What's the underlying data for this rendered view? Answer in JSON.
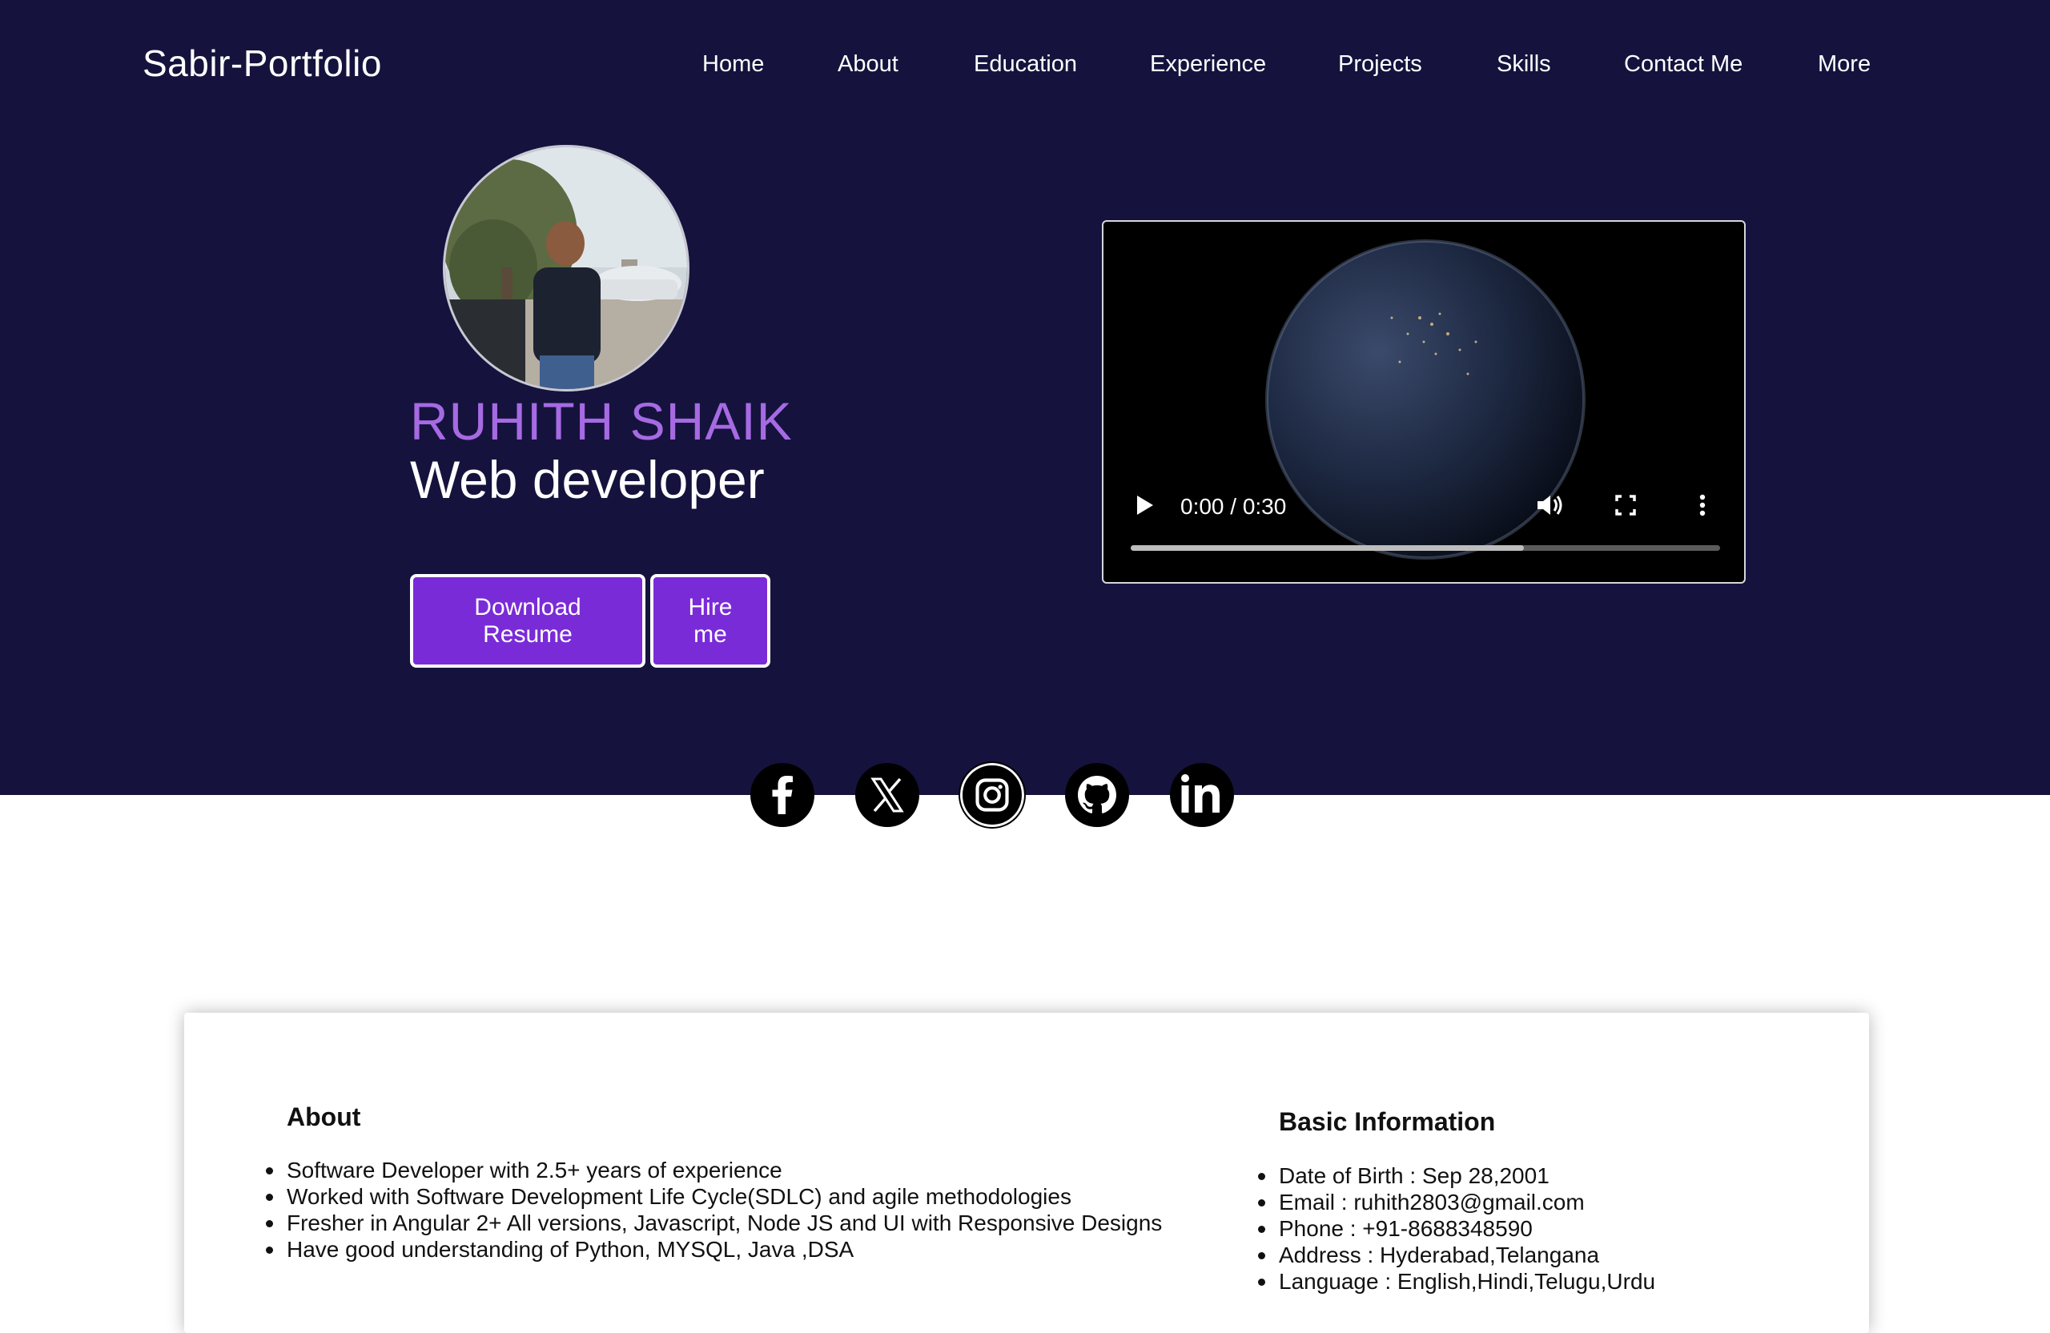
{
  "brand": "Sabir-Portfolio",
  "nav": [
    "Home",
    "About",
    "Education",
    "Experience",
    "Projects",
    "Skills",
    "Contact Me",
    "More"
  ],
  "profile": {
    "name": "RUHITH SHAIK",
    "role": "Web developer"
  },
  "buttons": {
    "download_line1": "Download",
    "download_line2": "Resume",
    "hire_line1": "Hire",
    "hire_line2": "me"
  },
  "video": {
    "time": "0:00 / 0:30",
    "progress_buffered": 0.667
  },
  "socials": [
    "facebook-icon",
    "x-icon",
    "instagram-icon",
    "github-icon",
    "linkedin-icon"
  ],
  "about": {
    "title": "About",
    "items": [
      "Software Developer with 2.5+ years of experience",
      "Worked with Software Development Life Cycle(SDLC) and agile methodologies",
      "Fresher in Angular 2+ All versions, Javascript, Node JS and UI with Responsive Designs",
      "Have good understanding of Python, MYSQL, Java ,DSA"
    ]
  },
  "basic_info": {
    "title": "Basic Information",
    "items": [
      "Date of Birth : Sep 28,2001",
      "Email : ruhith2803@gmail.com",
      "Phone : +91-8688348590",
      "Address : Hyderabad,Telangana",
      "Language : English,Hindi,Telugu,Urdu"
    ]
  },
  "colors": {
    "hero_bg": "#15133d",
    "accent": "#7a2bd8",
    "name": "#a66ae3"
  }
}
